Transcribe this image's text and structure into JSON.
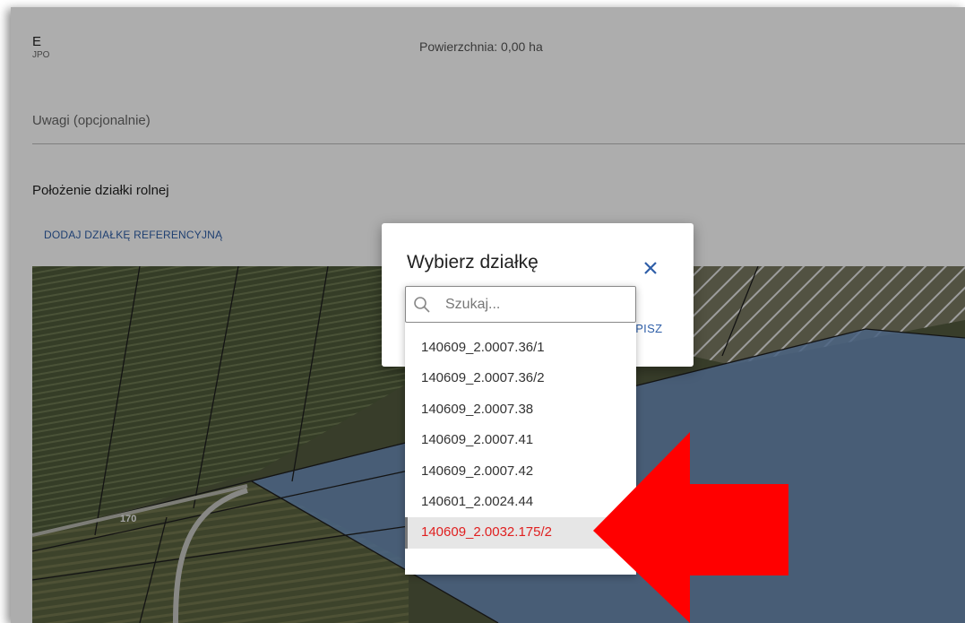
{
  "form": {
    "jpo_code": "E",
    "jpo_label": "JPO",
    "area": "Powierzchnia: 0,00 ha",
    "notes_placeholder": "Uwagi (opcjonalnie)",
    "section_title": "Położenie działki rolnej",
    "add_reference_label": "DODAJ DZIAŁKĘ REFERENCYJNĄ"
  },
  "map": {
    "parcel_label": "170",
    "field_color": "#6f93c2"
  },
  "dialog": {
    "title": "Wybierz działkę",
    "close_icon": "close-icon",
    "save_label": "ZAPISZ",
    "search_placeholder": "Szukaj...",
    "search_value": "",
    "options": [
      "140609_2.0007.36/1",
      "140609_2.0007.36/2",
      "140609_2.0007.38",
      "140609_2.0007.41",
      "140609_2.0007.42",
      "140601_2.0024.44",
      "140609_2.0032.175/2"
    ],
    "selected_option": "140609_2.0032.175/2"
  },
  "annotation": {
    "arrow_color": "#ff0000"
  }
}
